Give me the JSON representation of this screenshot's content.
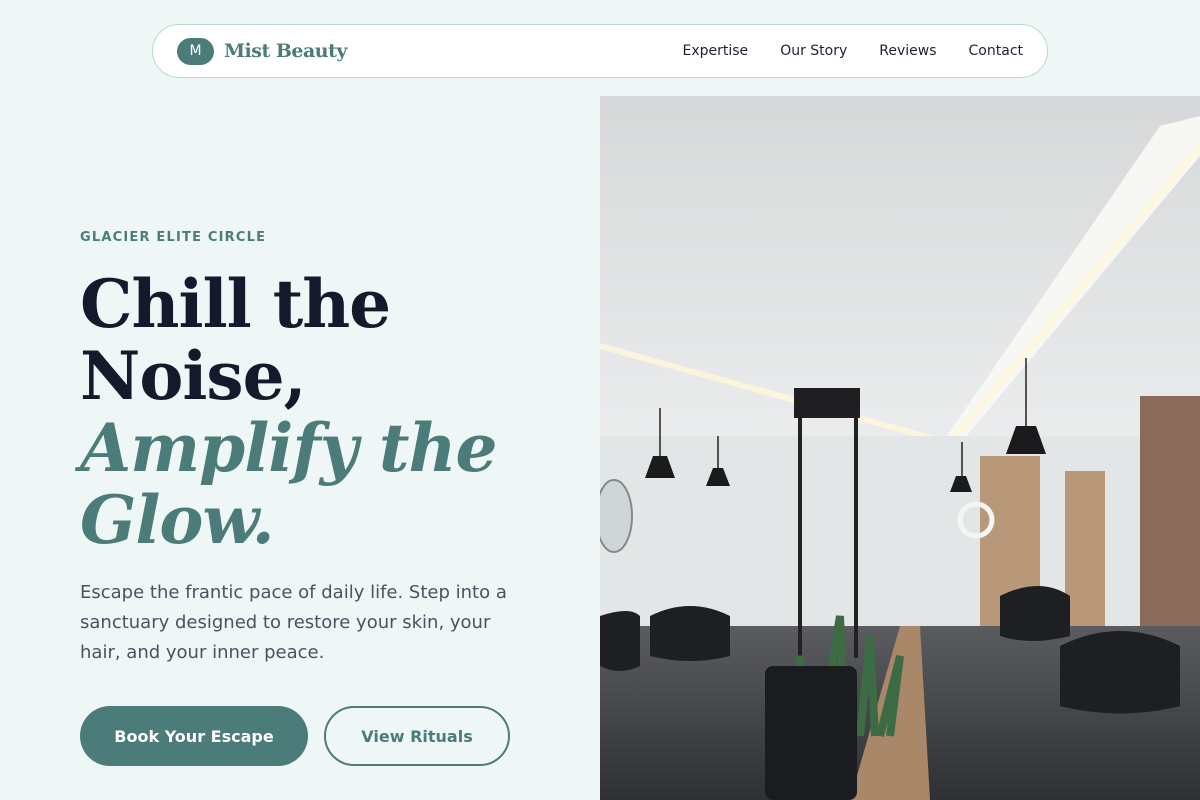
{
  "brand": {
    "badge_letter": "M",
    "name": "Mist Beauty"
  },
  "nav": {
    "items": [
      {
        "label": "Expertise"
      },
      {
        "label": "Our Story"
      },
      {
        "label": "Reviews"
      },
      {
        "label": "Contact"
      }
    ]
  },
  "hero": {
    "eyebrow": "GLACIER ELITE CIRCLE",
    "headline_line1": "Chill the",
    "headline_line2": "Noise,",
    "headline_accent1": "Amplify the",
    "headline_accent2": "Glow.",
    "subtext": "Escape the frantic pace of daily life. Step into a sanctuary designed to restore your skin, your hair, and your inner peace.",
    "primary_cta": "Book Your Escape",
    "secondary_cta": "View Rituals"
  },
  "colors": {
    "accent": "#4b7c79",
    "background": "#eef7f6",
    "heading": "#131a2b"
  },
  "image": {
    "description_icon": "salon-interior-photo"
  }
}
